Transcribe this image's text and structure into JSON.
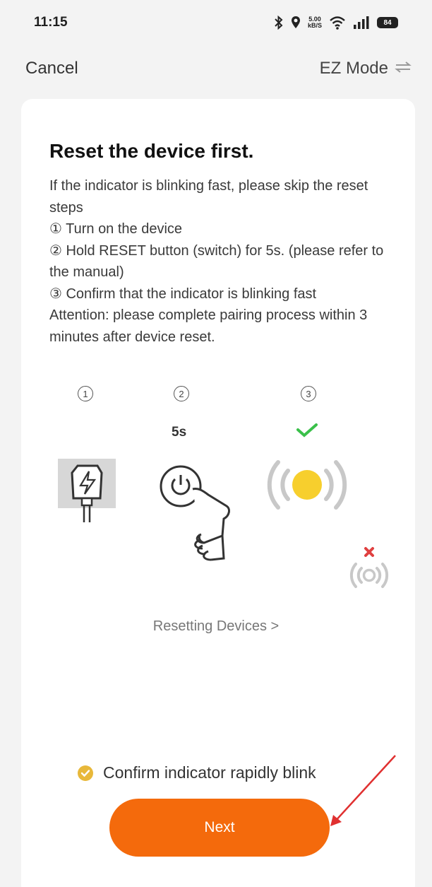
{
  "status_bar": {
    "time": "11:15",
    "speed_top": "5.00",
    "speed_bottom": "kB/S",
    "battery": "84"
  },
  "nav": {
    "cancel_label": "Cancel",
    "mode_label": "EZ Mode"
  },
  "content": {
    "title": "Reset the device first.",
    "instructions": [
      "If the indicator is blinking fast, please skip the reset steps",
      "① Turn on the device",
      "② Hold RESET button (switch) for 5s. (please refer to the manual)",
      "③ Confirm that the indicator is blinking fast",
      "Attention: please complete pairing process within 3 minutes after device reset."
    ]
  },
  "steps": {
    "step1": "1",
    "step2": "2",
    "step3": "3",
    "duration": "5s"
  },
  "resetting_link": "Resetting Devices >",
  "confirm_label": "Confirm indicator rapidly blink",
  "next_label": "Next",
  "colors": {
    "accent": "#f46a0c",
    "indicator": "#f7cf2d",
    "confirm": "#e8b83a",
    "success": "#3ac04a",
    "error": "#e04040",
    "arrow": "#e03030"
  }
}
